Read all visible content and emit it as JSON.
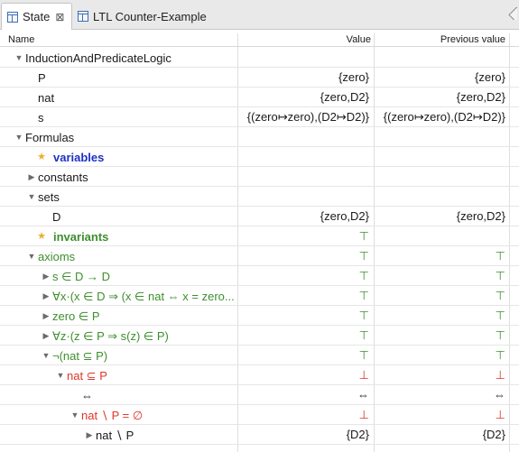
{
  "tabs": [
    {
      "label": "State",
      "close": "⊠"
    },
    {
      "label": "LTL Counter-Example"
    }
  ],
  "columns": {
    "name": "Name",
    "value": "Value",
    "previous": "Previous value"
  },
  "rows": [
    {
      "name": "InductionAndPredicateLogic",
      "value": "",
      "previous": ""
    },
    {
      "name": "P",
      "value": "{zero}",
      "previous": "{zero}"
    },
    {
      "name": "nat",
      "value": "{zero,D2}",
      "previous": "{zero,D2}"
    },
    {
      "name": "s",
      "value": "{(zero↦zero),(D2↦D2)}",
      "previous": "{(zero↦zero),(D2↦D2)}"
    },
    {
      "name": "Formulas",
      "value": "",
      "previous": ""
    },
    {
      "name": "variables",
      "value": "",
      "previous": ""
    },
    {
      "name": "constants",
      "value": "",
      "previous": ""
    },
    {
      "name": "sets",
      "value": "",
      "previous": ""
    },
    {
      "name": "D",
      "value": "{zero,D2}",
      "previous": "{zero,D2}"
    },
    {
      "name": "invariants",
      "value": "⊤",
      "previous": ""
    },
    {
      "name": "axioms",
      "value": "⊤",
      "previous": "⊤"
    },
    {
      "name": "s ∈ D → D",
      "value": "⊤",
      "previous": "⊤"
    },
    {
      "name": "∀x·(x ∈ D ⇒ (x ∈ nat ⇔ x = zero...",
      "value": "⊤",
      "previous": "⊤"
    },
    {
      "name": "zero ∈ P",
      "value": "⊤",
      "previous": "⊤"
    },
    {
      "name": "∀z·(z ∈ P ⇒ s(z) ∈ P)",
      "value": "⊤",
      "previous": "⊤"
    },
    {
      "name": "¬(nat ⊆ P)",
      "value": "⊤",
      "previous": "⊤"
    },
    {
      "name": "nat ⊆ P",
      "value": "⊥",
      "previous": "⊥"
    },
    {
      "name": "⇔",
      "value": "⇔",
      "previous": "⇔"
    },
    {
      "name": "nat ∖ P = ∅",
      "value": "⊥",
      "previous": "⊥"
    },
    {
      "name": "nat ∖ P",
      "value": "{D2}",
      "previous": "{D2}"
    }
  ],
  "icons": {
    "expanded": "▼",
    "collapsed": "▶",
    "star": "★"
  },
  "colors": {
    "true_green": "#3d8f2e",
    "false_red": "#e0352a",
    "variables_blue": "#1f30c4",
    "star_yellow": "#e8b12b"
  }
}
